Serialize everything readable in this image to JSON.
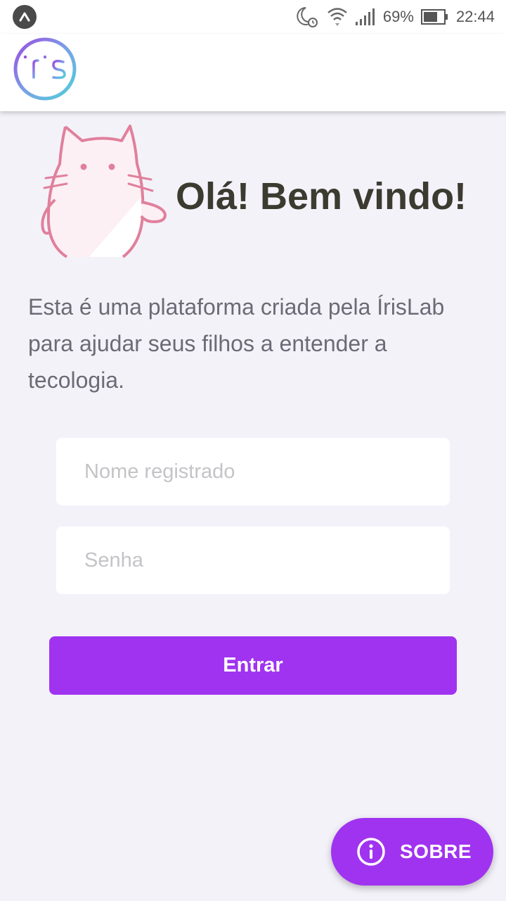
{
  "status_bar": {
    "battery": "69%",
    "time": "22:44",
    "icons": [
      "app-notification-icon",
      "moon-alarm-icon",
      "wifi-icon",
      "signal-icon",
      "battery-icon"
    ]
  },
  "header": {
    "logo": "Iris logo"
  },
  "hero": {
    "greeting": "Olá! Bem vindo!",
    "description": "Esta é uma plataforma criada pela ÍrisLab para ajudar seus filhos a entender a tecologia."
  },
  "form": {
    "username_placeholder": "Nome registrado",
    "username_value": "",
    "password_placeholder": "Senha",
    "password_value": "",
    "submit_label": "Entrar"
  },
  "fab": {
    "label": "SOBRE",
    "icon": "info-icon"
  },
  "colors": {
    "accent": "#a033f0",
    "background": "#f4f2f9"
  }
}
